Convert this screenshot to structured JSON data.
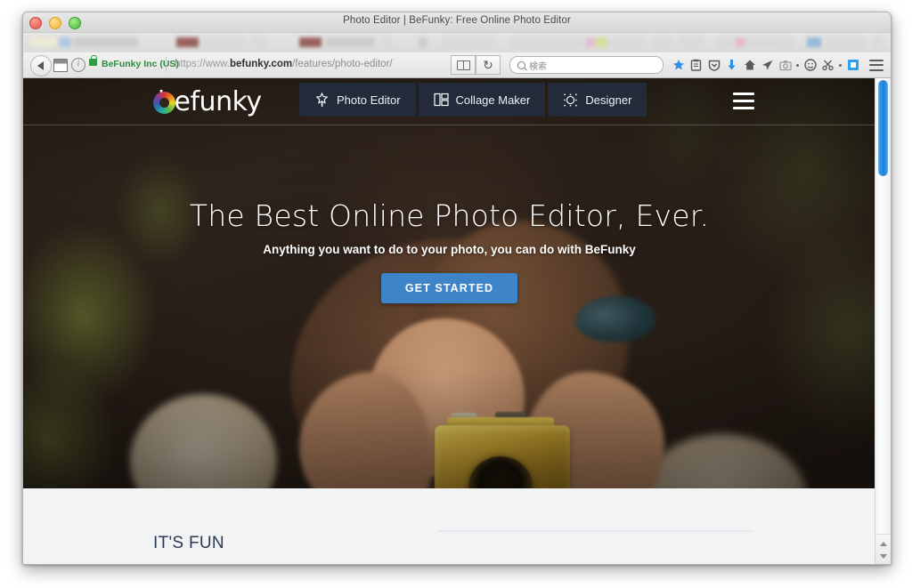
{
  "window": {
    "title": "Photo Editor | BeFunky: Free Online Photo Editor",
    "traffic_lights": [
      "close",
      "minimize",
      "zoom"
    ]
  },
  "browser": {
    "back_label": "Back",
    "reader_label": "Reader View",
    "reload_label": "Reload",
    "security": {
      "ev_label": "BeFunky Inc (US)",
      "lock": "lock-icon",
      "info": "i"
    },
    "url": {
      "scheme": "https://www.",
      "domain": "befunky.com",
      "path": "/features/photo-editor/"
    },
    "search": {
      "placeholder": "検索",
      "value": ""
    },
    "extensions": [
      "bookmark-star-icon",
      "clipboard-icon",
      "pocket-shield-icon",
      "download-arrow-icon",
      "home-icon",
      "send-paper-plane-icon",
      "screenshot-camera-icon",
      "overflow-dot",
      "smiley-face-icon",
      "scissors-icon",
      "overflow-dot-2",
      "blue-square-icon"
    ],
    "menu_label": "Open Menu"
  },
  "site": {
    "logo_text": "befunky",
    "nav": [
      {
        "label": "Photo Editor",
        "icon": "magic-wand-star-icon"
      },
      {
        "label": "Collage Maker",
        "icon": "collage-grid-icon"
      },
      {
        "label": "Designer",
        "icon": "designer-circle-icon"
      }
    ],
    "menu_label": "Menu",
    "hero": {
      "heading": "The Best Online Photo Editor, Ever.",
      "subheading": "Anything you want to do to your photo, you can do with BeFunky",
      "cta_label": "GET STARTED",
      "cta_color": "#3d85c8"
    },
    "section": {
      "title": "IT'S FUN"
    }
  },
  "scrollbar": {
    "up_label": "Scroll Up",
    "down_label": "Scroll Down",
    "thumb_color": "#2f8ede"
  }
}
